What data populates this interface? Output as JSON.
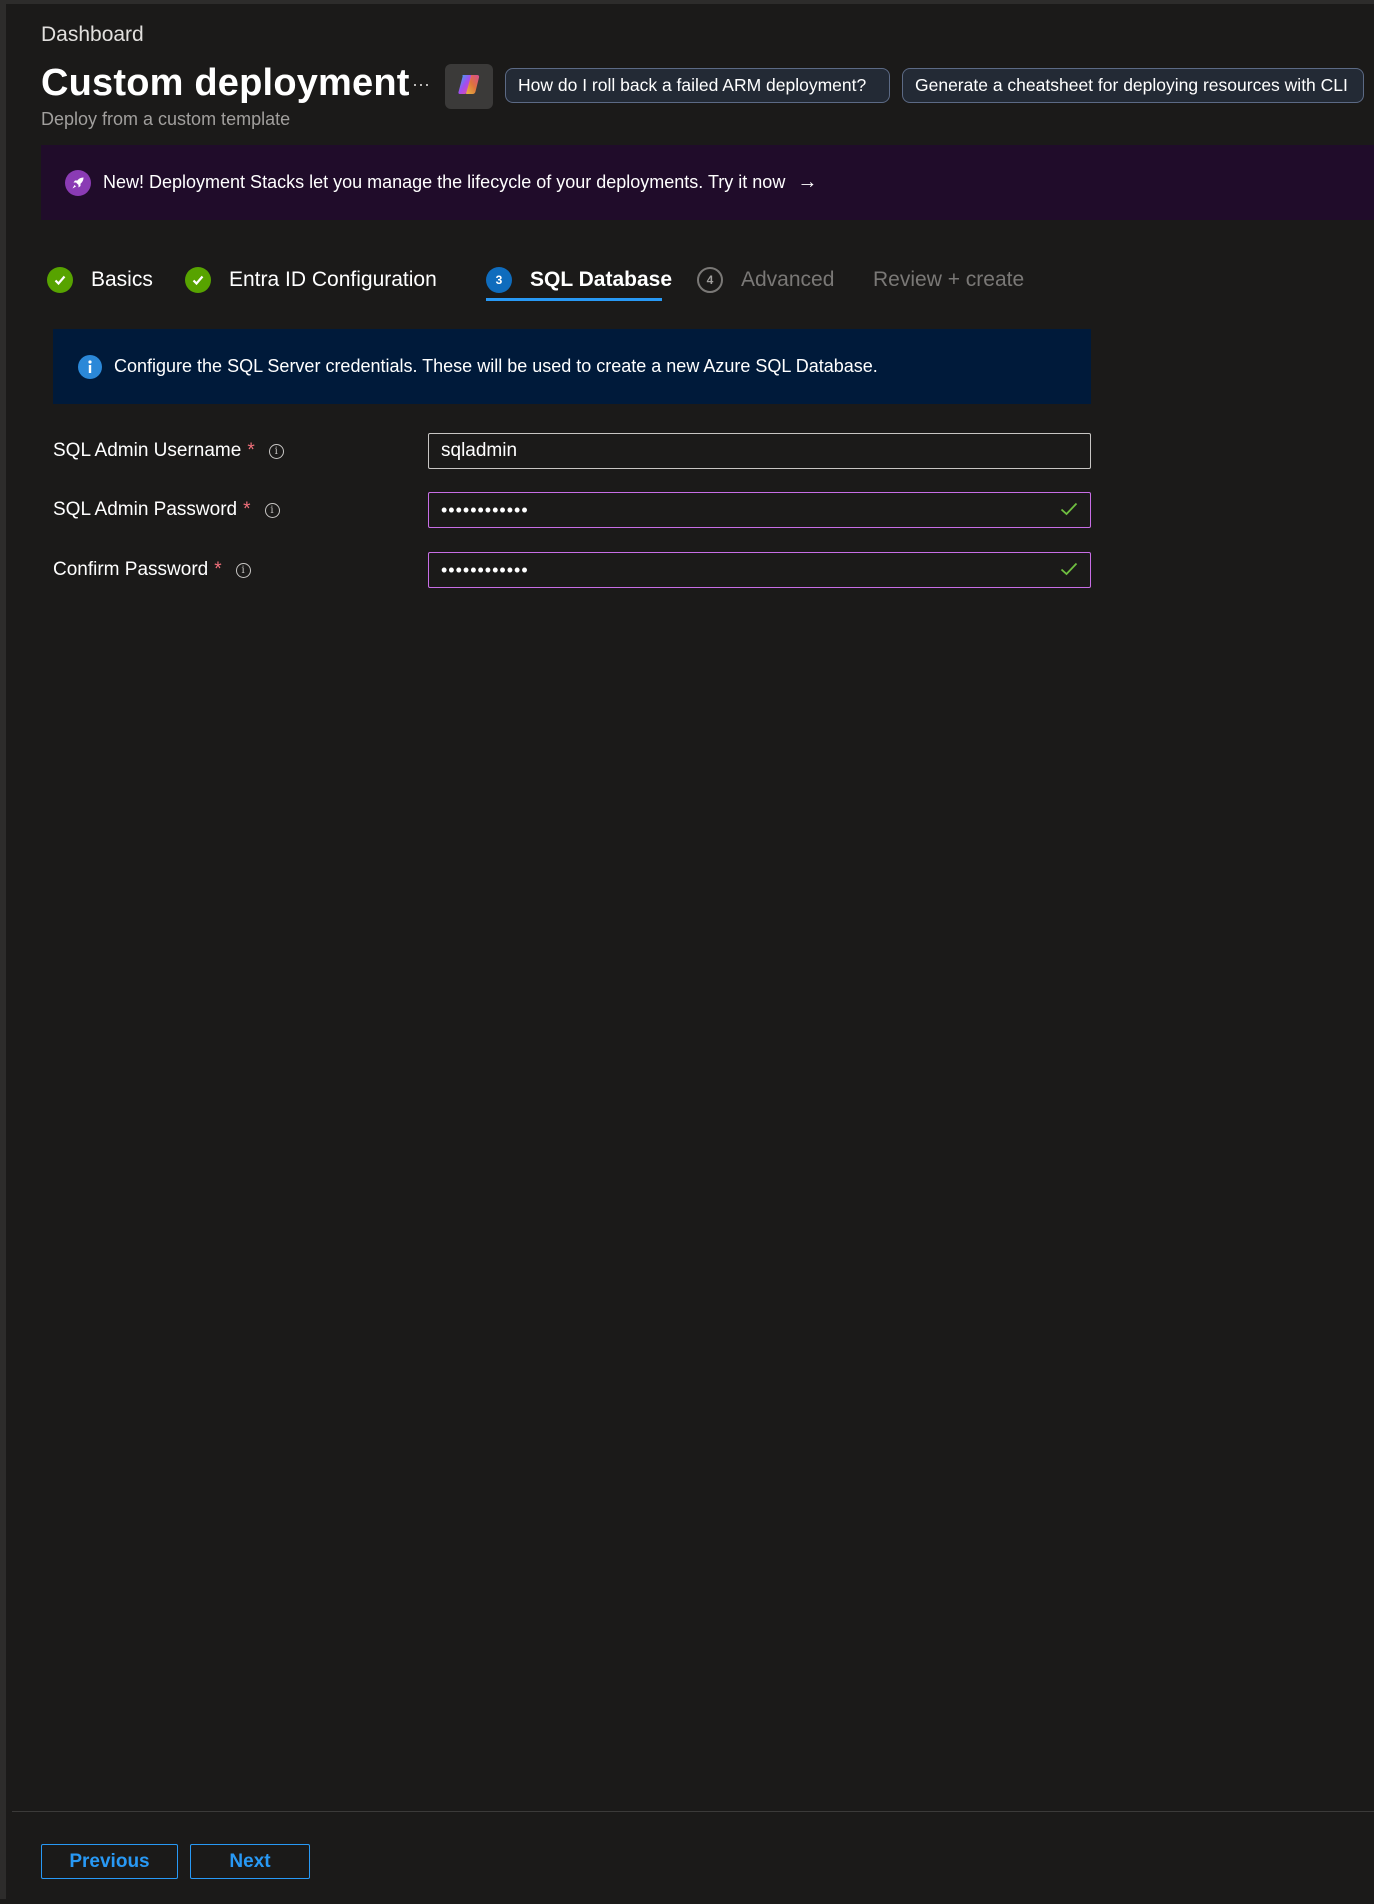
{
  "header": {
    "breadcrumb": "Dashboard",
    "title": "Custom deployment",
    "subtitle": "Deploy from a custom template",
    "more_label": "···",
    "copilot_icon": "copilot-icon",
    "chips": [
      "How do I roll back a failed ARM deployment?",
      "Generate a cheatsheet for deploying resources with CLI"
    ]
  },
  "banner": {
    "icon": "rocket-icon",
    "text": "New! Deployment Stacks let you manage the lifecycle of your deployments. Try it now",
    "arrow": "→"
  },
  "tabs": [
    {
      "label": "Basics",
      "state": "done"
    },
    {
      "label": "Entra ID Configuration",
      "state": "done"
    },
    {
      "label": "SQL Database",
      "state": "active",
      "step": "3"
    },
    {
      "label": "Advanced",
      "state": "disabled",
      "step": "4"
    },
    {
      "label": "Review + create",
      "state": "disabled"
    }
  ],
  "info": {
    "icon": "info-icon",
    "text": "Configure the SQL Server credentials. These will be used to create a new Azure SQL Database."
  },
  "form": {
    "username": {
      "label": "SQL Admin Username",
      "required": "*",
      "value": "sqladmin"
    },
    "password": {
      "label": "SQL Admin Password",
      "required": "*",
      "value": "••••••••••••"
    },
    "confirm": {
      "label": "Confirm Password",
      "required": "*",
      "value": "••••••••••••"
    }
  },
  "footer": {
    "previous": "Previous",
    "next": "Next"
  },
  "colors": {
    "background": "#1b1a19",
    "accent": "#2899f5",
    "success": "#57a300",
    "banner_bg": "#200c2a",
    "info_bg": "#001a3a",
    "required": "#f1707b"
  }
}
